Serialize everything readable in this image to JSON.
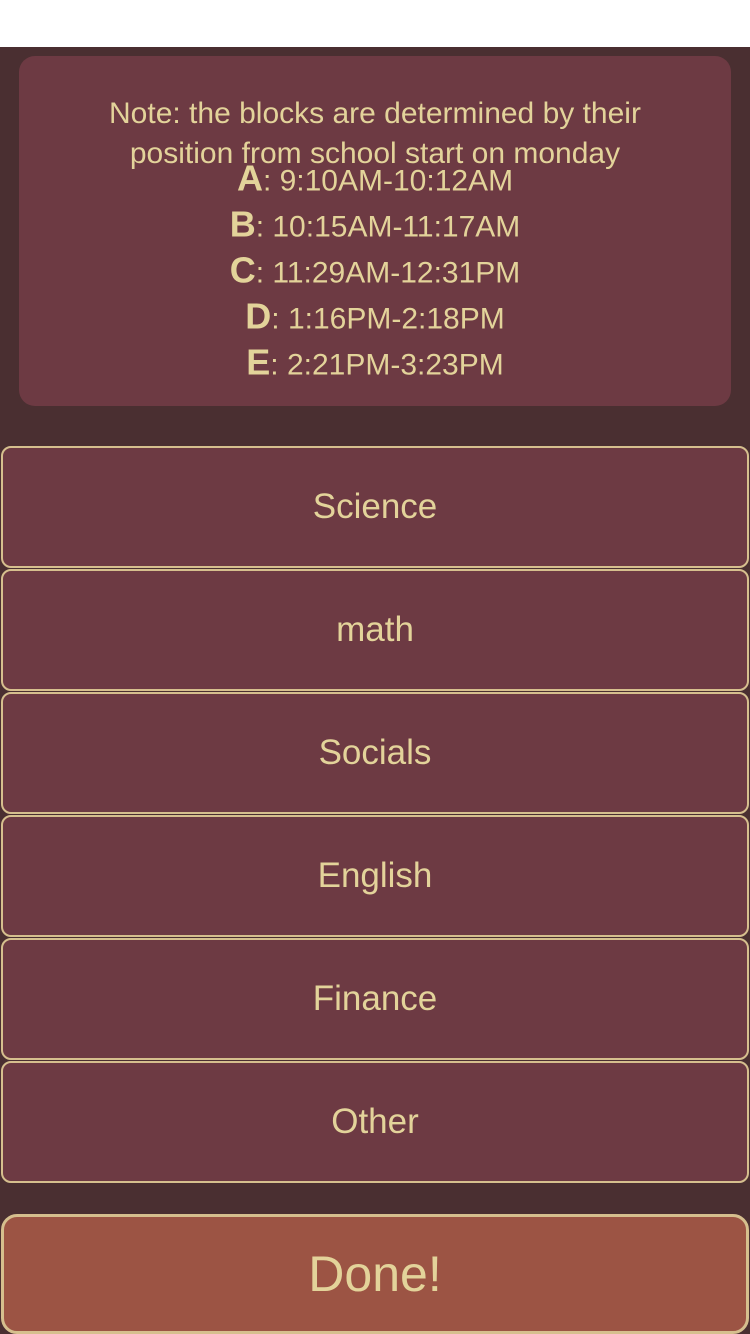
{
  "note": {
    "line1": "Note: the blocks are determined by their",
    "line2": "position from school start on monday",
    "blocks": [
      {
        "letter": "A",
        "time": ": 9:10AM-10:12AM"
      },
      {
        "letter": "B",
        "time": ": 10:15AM-11:17AM"
      },
      {
        "letter": "C",
        "time": ": 11:29AM-12:31PM"
      },
      {
        "letter": "D",
        "time": ": 1:16PM-2:18PM"
      },
      {
        "letter": "E",
        "time": ": 2:21PM-3:23PM"
      }
    ]
  },
  "subjects": [
    {
      "label": "Science"
    },
    {
      "label": "math"
    },
    {
      "label": "Socials"
    },
    {
      "label": "English"
    },
    {
      "label": "Finance"
    },
    {
      "label": "Other"
    }
  ],
  "done_label": "Done!",
  "colors": {
    "background": "#4a2f31",
    "card": "#6d3a43",
    "text": "#e3d39a",
    "border": "#d6bf8e",
    "done_button": "#9c5444"
  }
}
